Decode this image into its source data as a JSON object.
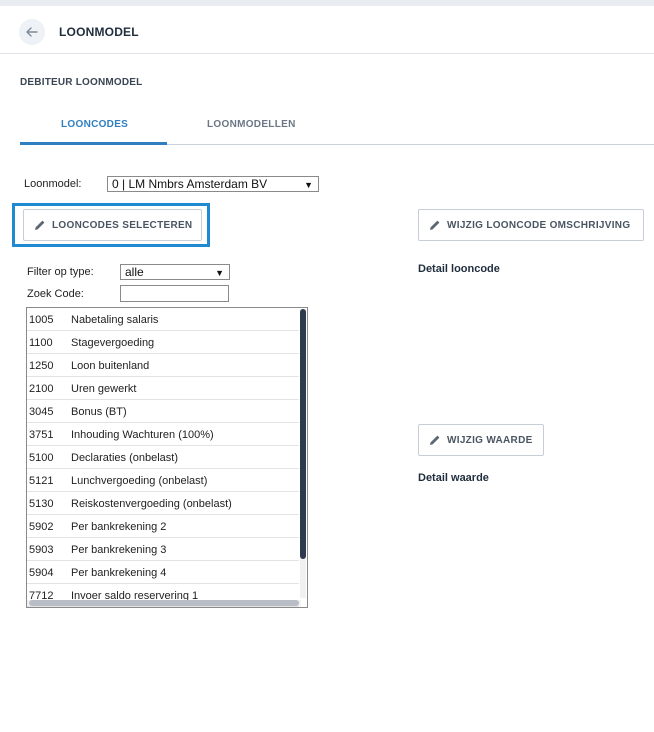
{
  "header": {
    "title": "LOONMODEL",
    "back_icon": "arrow-left-icon"
  },
  "section": {
    "title": "DEBITEUR LOONMODEL"
  },
  "tabs": [
    {
      "label": "LOONCODES",
      "active": true
    },
    {
      "label": "LOONMODELLEN",
      "active": false
    }
  ],
  "loonmodel": {
    "label": "Loonmodel:",
    "selected": "0 | LM Nmbrs Amsterdam BV"
  },
  "buttons": {
    "select_codes": "LOONCODES SELECTEREN",
    "edit_description": "WIJZIG LOONCODE OMSCHRIJVING",
    "edit_value": "WIJZIG WAARDE",
    "icon": "pencil-icon"
  },
  "filter": {
    "label": "Filter op type:",
    "selected": "alle"
  },
  "search": {
    "label": "Zoek Code:",
    "value": ""
  },
  "codes": [
    {
      "code": "1005",
      "description": "Nabetaling salaris"
    },
    {
      "code": "1100",
      "description": "Stagevergoeding"
    },
    {
      "code": "1250",
      "description": "Loon buitenland"
    },
    {
      "code": "2100",
      "description": "Uren gewerkt"
    },
    {
      "code": "3045",
      "description": "Bonus (BT)"
    },
    {
      "code": "3751",
      "description": "Inhouding Wachturen (100%)"
    },
    {
      "code": "5100",
      "description": "Declaraties (onbelast)"
    },
    {
      "code": "5121",
      "description": "Lunchvergoeding (onbelast)"
    },
    {
      "code": "5130",
      "description": "Reiskostenvergoeding (onbelast)"
    },
    {
      "code": "5902",
      "description": "Per bankrekening 2"
    },
    {
      "code": "5903",
      "description": "Per bankrekening 3"
    },
    {
      "code": "5904",
      "description": "Per bankrekening 4"
    },
    {
      "code": "7712",
      "description": "Invoer saldo reservering 1"
    }
  ],
  "details": {
    "code_label": "Detail looncode",
    "value_label": "Detail waarde"
  },
  "colors": {
    "accent": "#2f7fc1",
    "highlight": "#1f8ad1"
  }
}
